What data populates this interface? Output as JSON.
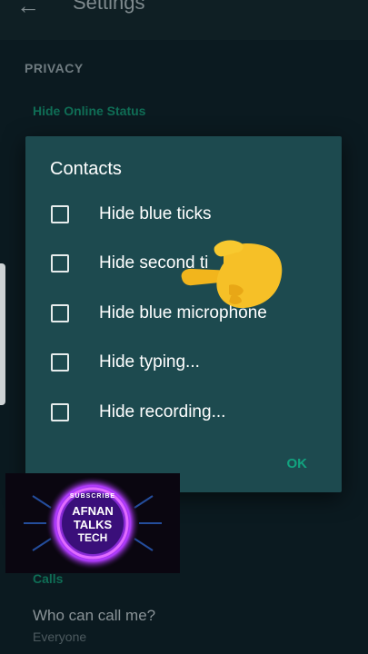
{
  "screen": {
    "title": "Settings",
    "section_privacy": "PRIVACY",
    "hide_online_status": "Hide Online Status",
    "calls_label": "Calls",
    "who_can_call": "Who can call me?",
    "who_can_call_value": "Everyone"
  },
  "dialog": {
    "title": "Contacts",
    "options": [
      {
        "label": "Hide blue ticks",
        "checked": false
      },
      {
        "label": "Hide second ti",
        "checked": false
      },
      {
        "label": "Hide blue microphone",
        "checked": false
      },
      {
        "label": "Hide typing...",
        "checked": false
      },
      {
        "label": "Hide recording...",
        "checked": false
      }
    ],
    "ok_label": "OK"
  },
  "overlay": {
    "subscribe": "SUBSCRIBE",
    "line1": "AFNAN",
    "line2": "TALKS",
    "line3": "TECH"
  },
  "colors": {
    "background": "#0b1a20",
    "dialog": "#1d4a4f",
    "accent": "#12a37f",
    "logo_glow": "#b23cff"
  },
  "icons": {
    "back": "back-arrow-icon",
    "pointer": "pointing-hand-icon",
    "checkbox": "checkbox-unchecked-icon"
  }
}
